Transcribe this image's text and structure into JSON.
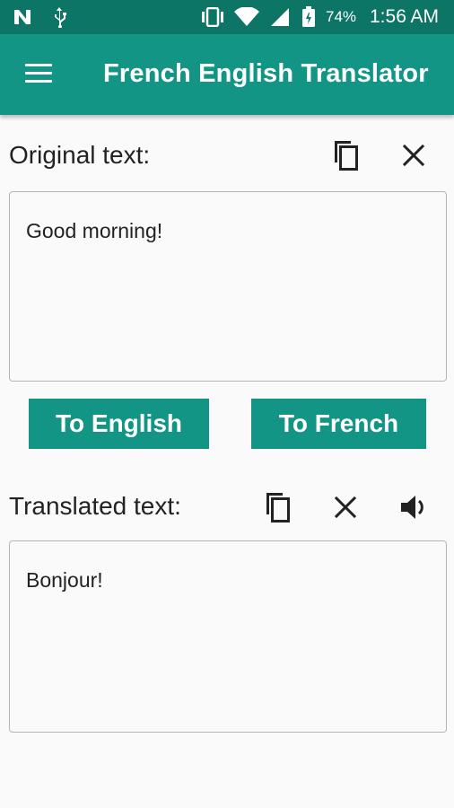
{
  "status_bar": {
    "battery_percent": "74%",
    "time": "1:56 AM",
    "icons": [
      "n-icon",
      "usb-icon",
      "vibrate-icon",
      "wifi-icon",
      "signal-icon",
      "battery-icon"
    ]
  },
  "app_bar": {
    "title": "French English Translator",
    "menu_icon": "menu-icon"
  },
  "original": {
    "label": "Original text:",
    "value": "Good morning!",
    "actions": [
      "copy-icon",
      "close-icon"
    ]
  },
  "buttons": {
    "to_english": "To English",
    "to_french": "To French"
  },
  "translated": {
    "label": "Translated text:",
    "value": "Bonjour!",
    "actions": [
      "copy-icon",
      "close-icon",
      "speaker-icon"
    ]
  },
  "colors": {
    "primary": "#129585",
    "status_bar": "#0c7565"
  }
}
